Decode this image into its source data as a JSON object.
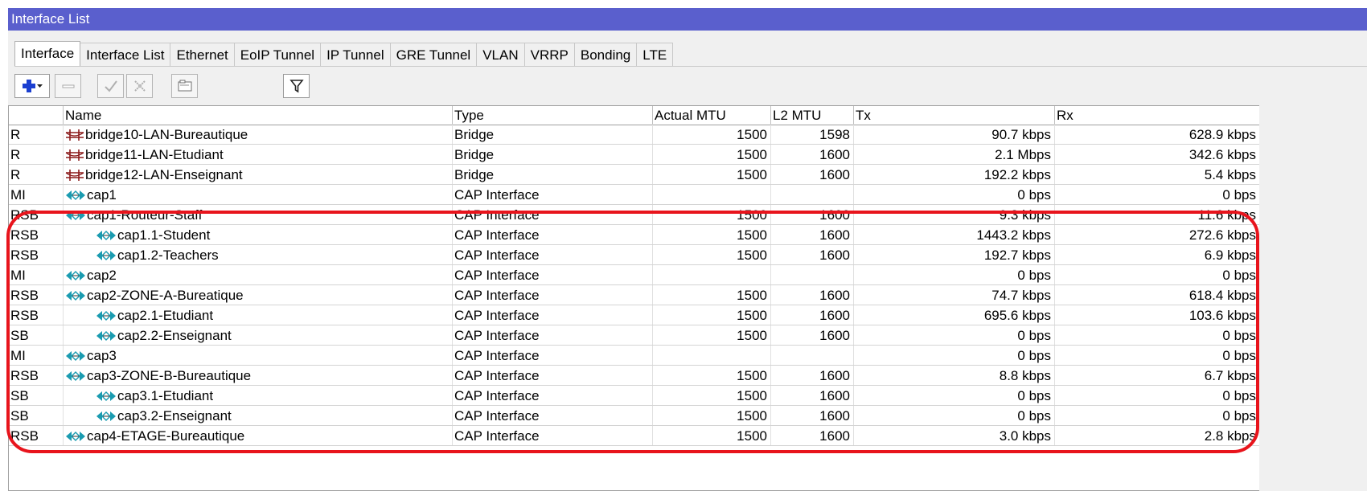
{
  "window": {
    "title": "Interface List"
  },
  "tabs": [
    "Interface",
    "Interface List",
    "Ethernet",
    "EoIP Tunnel",
    "IP Tunnel",
    "GRE Tunnel",
    "VLAN",
    "VRRP",
    "Bonding",
    "LTE"
  ],
  "active_tab": "Interface",
  "toolbar": [
    {
      "name": "add-button",
      "icon": "plus-icon"
    },
    {
      "name": "remove-button",
      "icon": "minus-icon"
    },
    {
      "name": "enable-button",
      "icon": "check-icon"
    },
    {
      "name": "disable-button",
      "icon": "cross-icon"
    },
    {
      "name": "comment-button",
      "icon": "comment-icon"
    },
    {
      "name": "filter-button",
      "icon": "filter-icon"
    }
  ],
  "table": {
    "columns": [
      "",
      "Name",
      "Type",
      "Actual MTU",
      "L2 MTU",
      "Tx",
      "Rx"
    ],
    "rows": [
      {
        "flags": "R",
        "name": "bridge10-LAN-Bureautique",
        "icon": "bridge-icon",
        "indent": 0,
        "type": "Bridge",
        "mtu": "1500",
        "l2mtu": "1598",
        "tx": "90.7 kbps",
        "rx": "628.9 kbps"
      },
      {
        "flags": "R",
        "name": "bridge11-LAN-Etudiant",
        "icon": "bridge-icon",
        "indent": 0,
        "type": "Bridge",
        "mtu": "1500",
        "l2mtu": "1600",
        "tx": "2.1 Mbps",
        "rx": "342.6 kbps"
      },
      {
        "flags": "R",
        "name": "bridge12-LAN-Enseignant",
        "icon": "bridge-icon",
        "indent": 0,
        "type": "Bridge",
        "mtu": "1500",
        "l2mtu": "1600",
        "tx": "192.2 kbps",
        "rx": "5.4 kbps"
      },
      {
        "flags": "MI",
        "name": "cap1",
        "icon": "wireless-icon",
        "indent": 0,
        "type": "CAP Interface",
        "mtu": "",
        "l2mtu": "",
        "tx": "0 bps",
        "rx": "0 bps"
      },
      {
        "flags": "RSB",
        "name": "cap1-Routeur-Staff",
        "icon": "wireless-icon",
        "indent": 0,
        "type": "CAP Interface",
        "mtu": "1500",
        "l2mtu": "1600",
        "tx": "9.3 kbps",
        "rx": "11.6 kbps"
      },
      {
        "flags": "RSB",
        "name": "cap1.1-Student",
        "icon": "wireless-icon",
        "indent": 1,
        "type": "CAP Interface",
        "mtu": "1500",
        "l2mtu": "1600",
        "tx": "1443.2 kbps",
        "rx": "272.6 kbps"
      },
      {
        "flags": "RSB",
        "name": "cap1.2-Teachers",
        "icon": "wireless-icon",
        "indent": 1,
        "type": "CAP Interface",
        "mtu": "1500",
        "l2mtu": "1600",
        "tx": "192.7 kbps",
        "rx": "6.9 kbps"
      },
      {
        "flags": "MI",
        "name": "cap2",
        "icon": "wireless-icon",
        "indent": 0,
        "type": "CAP Interface",
        "mtu": "",
        "l2mtu": "",
        "tx": "0 bps",
        "rx": "0 bps"
      },
      {
        "flags": "RSB",
        "name": "cap2-ZONE-A-Bureatique",
        "icon": "wireless-icon",
        "indent": 0,
        "type": "CAP Interface",
        "mtu": "1500",
        "l2mtu": "1600",
        "tx": "74.7 kbps",
        "rx": "618.4 kbps"
      },
      {
        "flags": "RSB",
        "name": "cap2.1-Etudiant",
        "icon": "wireless-icon",
        "indent": 1,
        "type": "CAP Interface",
        "mtu": "1500",
        "l2mtu": "1600",
        "tx": "695.6 kbps",
        "rx": "103.6 kbps"
      },
      {
        "flags": "SB",
        "name": "cap2.2-Enseignant",
        "icon": "wireless-icon",
        "indent": 1,
        "type": "CAP Interface",
        "mtu": "1500",
        "l2mtu": "1600",
        "tx": "0 bps",
        "rx": "0 bps"
      },
      {
        "flags": "MI",
        "name": "cap3",
        "icon": "wireless-icon",
        "indent": 0,
        "type": "CAP Interface",
        "mtu": "",
        "l2mtu": "",
        "tx": "0 bps",
        "rx": "0 bps"
      },
      {
        "flags": "RSB",
        "name": "cap3-ZONE-B-Bureautique",
        "icon": "wireless-icon",
        "indent": 0,
        "type": "CAP Interface",
        "mtu": "1500",
        "l2mtu": "1600",
        "tx": "8.8 kbps",
        "rx": "6.7 kbps"
      },
      {
        "flags": "SB",
        "name": "cap3.1-Etudiant",
        "icon": "wireless-icon",
        "indent": 1,
        "type": "CAP Interface",
        "mtu": "1500",
        "l2mtu": "1600",
        "tx": "0 bps",
        "rx": "0 bps"
      },
      {
        "flags": "SB",
        "name": "cap3.2-Enseignant",
        "icon": "wireless-icon",
        "indent": 1,
        "type": "CAP Interface",
        "mtu": "1500",
        "l2mtu": "1600",
        "tx": "0 bps",
        "rx": "0 bps"
      },
      {
        "flags": "RSB",
        "name": "cap4-ETAGE-Bureautique",
        "icon": "wireless-icon",
        "indent": 0,
        "type": "CAP Interface",
        "mtu": "1500",
        "l2mtu": "1600",
        "tx": "3.0 kbps",
        "rx": "2.8 kbps"
      }
    ]
  },
  "colors": {
    "titlebar": "#5a5fcd",
    "highlight": "#e8141c",
    "bridge_icon": "#8b1a1a",
    "wireless_icon": "#1a9bb0",
    "add_icon": "#1b3fd0"
  }
}
